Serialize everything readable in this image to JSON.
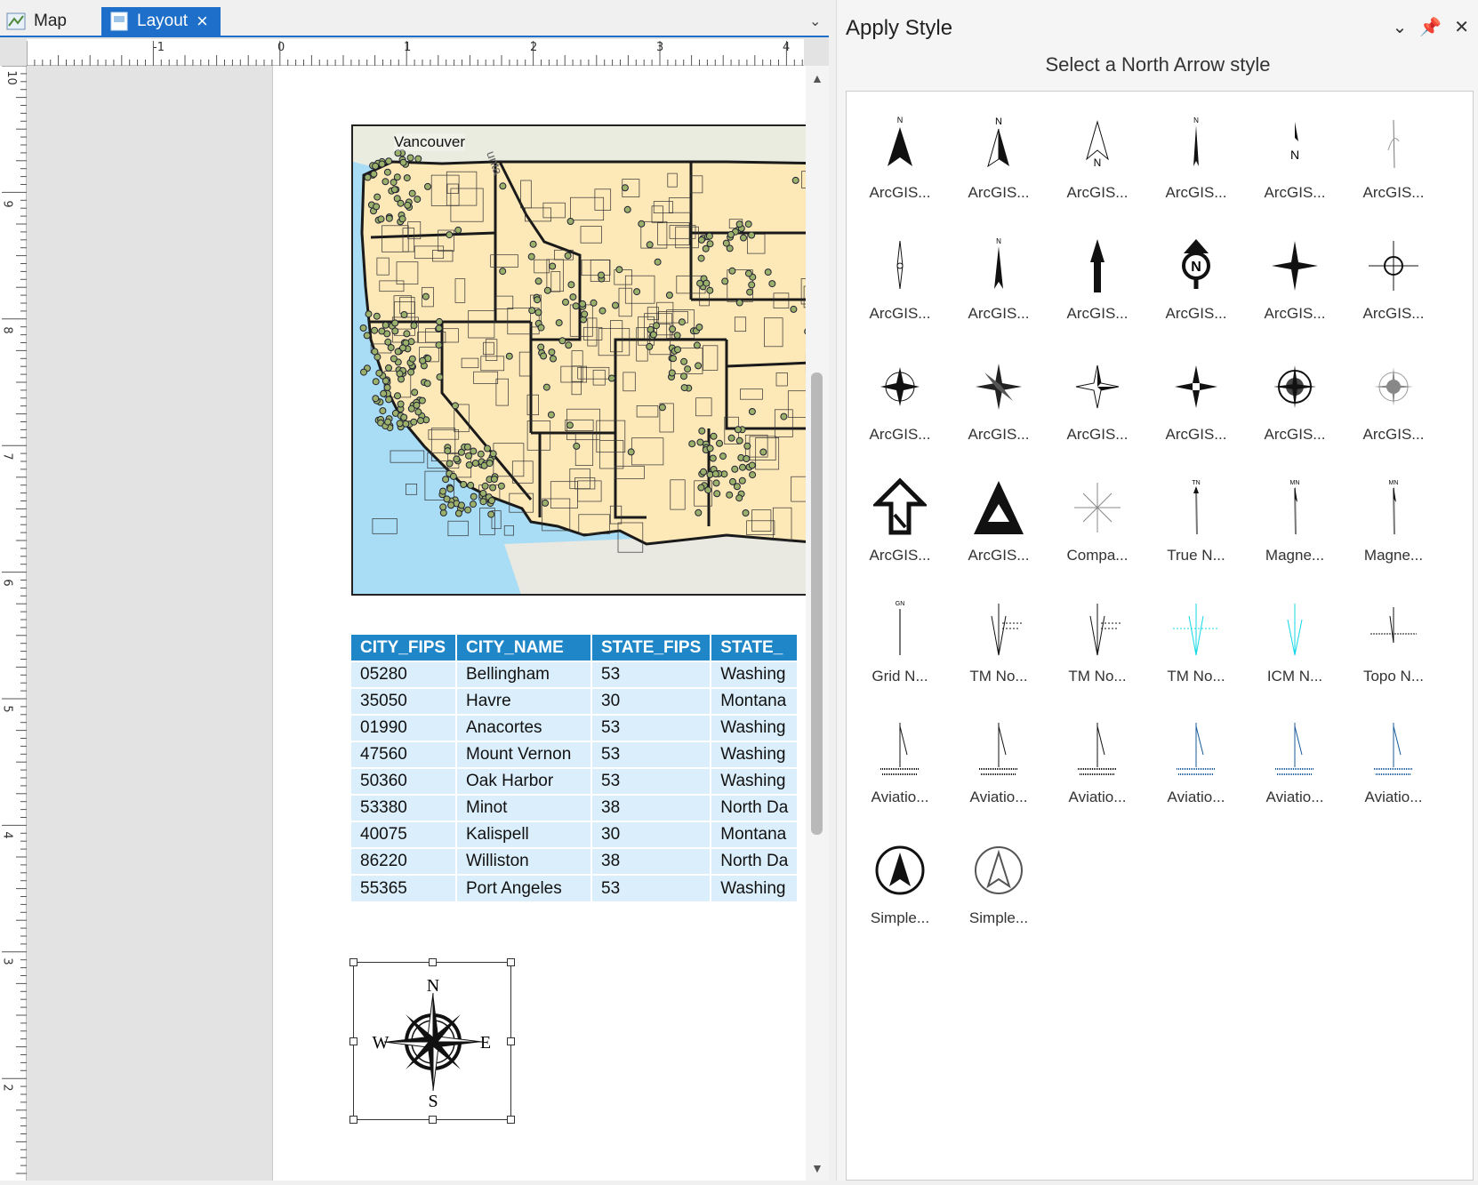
{
  "tabs": [
    {
      "label": "Map",
      "active": false
    },
    {
      "label": "Layout",
      "active": true
    }
  ],
  "ruler": {
    "horizontal": [
      "-1",
      "0",
      "1",
      "2",
      "3",
      "4"
    ],
    "vertical": [
      "10",
      "9",
      "8",
      "7",
      "6",
      "5",
      "4",
      "3",
      "2"
    ]
  },
  "map": {
    "label": "Vancouver",
    "colors": {
      "land": "#fde8b8",
      "water": "#a9dcf5",
      "border": "#1a1a1a",
      "point": "#9bb06a"
    }
  },
  "table": {
    "headers": [
      "CITY_FIPS",
      "CITY_NAME",
      "STATE_FIPS",
      "STATE_"
    ],
    "rows": [
      [
        "05280",
        "Bellingham",
        "53",
        "Washing"
      ],
      [
        "35050",
        "Havre",
        "30",
        "Montana"
      ],
      [
        "01990",
        "Anacortes",
        "53",
        "Washing"
      ],
      [
        "47560",
        "Mount Vernon",
        "53",
        "Washing"
      ],
      [
        "50360",
        "Oak Harbor",
        "53",
        "Washing"
      ],
      [
        "53380",
        "Minot",
        "38",
        "North Da"
      ],
      [
        "40075",
        "Kalispell",
        "30",
        "Montana"
      ],
      [
        "86220",
        "Williston",
        "38",
        "North Da"
      ],
      [
        "55365",
        "Port Angeles",
        "53",
        "Washing"
      ]
    ]
  },
  "compass": {
    "n": "N",
    "e": "E",
    "s": "S",
    "w": "W"
  },
  "pane": {
    "title": "Apply Style",
    "subtitle": "Select a North Arrow style",
    "items": [
      {
        "label": "ArcGIS...",
        "icon": "north-arrow-solid"
      },
      {
        "label": "ArcGIS...",
        "icon": "north-arrow-split"
      },
      {
        "label": "ArcGIS...",
        "icon": "north-arrow-outline"
      },
      {
        "label": "ArcGIS...",
        "icon": "north-arrow-thin"
      },
      {
        "label": "ArcGIS...",
        "icon": "north-arrow-half"
      },
      {
        "label": "ArcGIS...",
        "icon": "north-arrow-script"
      },
      {
        "label": "ArcGIS...",
        "icon": "north-arrow-needle"
      },
      {
        "label": "ArcGIS...",
        "icon": "north-arrow-slim"
      },
      {
        "label": "ArcGIS...",
        "icon": "north-arrow-bold"
      },
      {
        "label": "ArcGIS...",
        "icon": "north-arrow-circle-n"
      },
      {
        "label": "ArcGIS...",
        "icon": "north-arrow-star"
      },
      {
        "label": "ArcGIS...",
        "icon": "north-arrow-ring"
      },
      {
        "label": "ArcGIS...",
        "icon": "compass-rose"
      },
      {
        "label": "ArcGIS...",
        "icon": "compass-star"
      },
      {
        "label": "ArcGIS...",
        "icon": "compass-nesw"
      },
      {
        "label": "ArcGIS...",
        "icon": "compass-nesw-bold"
      },
      {
        "label": "ArcGIS...",
        "icon": "compass-rose-dark"
      },
      {
        "label": "ArcGIS...",
        "icon": "compass-rose-gray"
      },
      {
        "label": "ArcGIS...",
        "icon": "north-arrow-outline-bold"
      },
      {
        "label": "ArcGIS...",
        "icon": "north-arrow-triangle"
      },
      {
        "label": "Compa...",
        "icon": "compass-thin"
      },
      {
        "label": "True N...",
        "icon": "true-north-arrow"
      },
      {
        "label": "Magne...",
        "icon": "magnetic-north-arrow"
      },
      {
        "label": "Magne...",
        "icon": "magnetic-north-arrow"
      },
      {
        "label": "Grid N...",
        "icon": "grid-north-arrow"
      },
      {
        "label": "TM No...",
        "icon": "tm-north-arrow"
      },
      {
        "label": "TM No...",
        "icon": "tm-north-arrow"
      },
      {
        "label": "TM No...",
        "icon": "tm-north-arrow-cyan"
      },
      {
        "label": "ICM N...",
        "icon": "icm-north-arrow-cyan"
      },
      {
        "label": "Topo N...",
        "icon": "topo-north-arrow"
      },
      {
        "label": "Aviatio...",
        "icon": "aviation-north-arrow"
      },
      {
        "label": "Aviatio...",
        "icon": "aviation-north-arrow"
      },
      {
        "label": "Aviatio...",
        "icon": "aviation-north-arrow"
      },
      {
        "label": "Aviatio...",
        "icon": "aviation-north-arrow-blue"
      },
      {
        "label": "Aviatio...",
        "icon": "aviation-north-arrow-blue"
      },
      {
        "label": "Aviatio...",
        "icon": "aviation-north-arrow-blue"
      },
      {
        "label": "Simple...",
        "icon": "simple-circle-arrow-filled"
      },
      {
        "label": "Simple...",
        "icon": "simple-circle-arrow-outline"
      }
    ]
  }
}
